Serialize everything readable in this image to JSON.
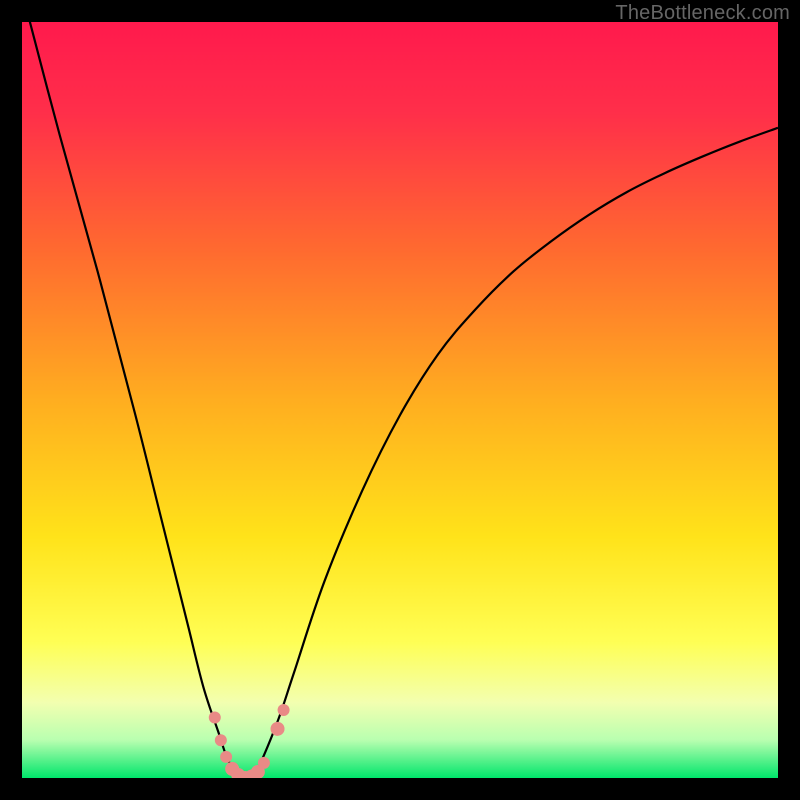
{
  "watermark": "TheBottleneck.com",
  "chart_data": {
    "type": "line",
    "title": "",
    "xlabel": "",
    "ylabel": "",
    "xlim": [
      0,
      100
    ],
    "ylim": [
      0,
      100
    ],
    "gradient_stops": [
      {
        "pos": 0.0,
        "color": "#ff1a4d"
      },
      {
        "pos": 0.12,
        "color": "#ff2f4a"
      },
      {
        "pos": 0.3,
        "color": "#ff6a30"
      },
      {
        "pos": 0.5,
        "color": "#ffae20"
      },
      {
        "pos": 0.68,
        "color": "#ffe31a"
      },
      {
        "pos": 0.82,
        "color": "#ffff55"
      },
      {
        "pos": 0.9,
        "color": "#f3ffb0"
      },
      {
        "pos": 0.95,
        "color": "#b9ffb0"
      },
      {
        "pos": 1.0,
        "color": "#00e66b"
      }
    ],
    "series": [
      {
        "name": "bottleneck-curve",
        "x": [
          0,
          5,
          10,
          15,
          18,
          20,
          22,
          24,
          26,
          27,
          28,
          29,
          30,
          31,
          32,
          34,
          36,
          40,
          45,
          50,
          55,
          60,
          65,
          70,
          75,
          80,
          85,
          90,
          95,
          100
        ],
        "y": [
          104,
          85,
          67,
          48,
          36,
          28,
          20,
          12,
          6,
          3,
          1,
          0,
          0,
          1,
          3,
          8,
          14,
          26,
          38,
          48,
          56,
          62,
          67,
          71,
          74.5,
          77.5,
          80,
          82.2,
          84.2,
          86
        ]
      }
    ],
    "markers": {
      "name": "highlight-points",
      "color": "#e98a86",
      "points": [
        {
          "x": 25.5,
          "y": 8.0,
          "r": 6
        },
        {
          "x": 26.3,
          "y": 5.0,
          "r": 6
        },
        {
          "x": 27.0,
          "y": 2.8,
          "r": 6
        },
        {
          "x": 27.8,
          "y": 1.2,
          "r": 7
        },
        {
          "x": 28.6,
          "y": 0.4,
          "r": 7
        },
        {
          "x": 29.5,
          "y": 0.0,
          "r": 7
        },
        {
          "x": 30.4,
          "y": 0.2,
          "r": 7
        },
        {
          "x": 31.2,
          "y": 0.8,
          "r": 7
        },
        {
          "x": 32.0,
          "y": 2.0,
          "r": 6
        },
        {
          "x": 33.8,
          "y": 6.5,
          "r": 7
        },
        {
          "x": 34.6,
          "y": 9.0,
          "r": 6
        }
      ]
    }
  }
}
